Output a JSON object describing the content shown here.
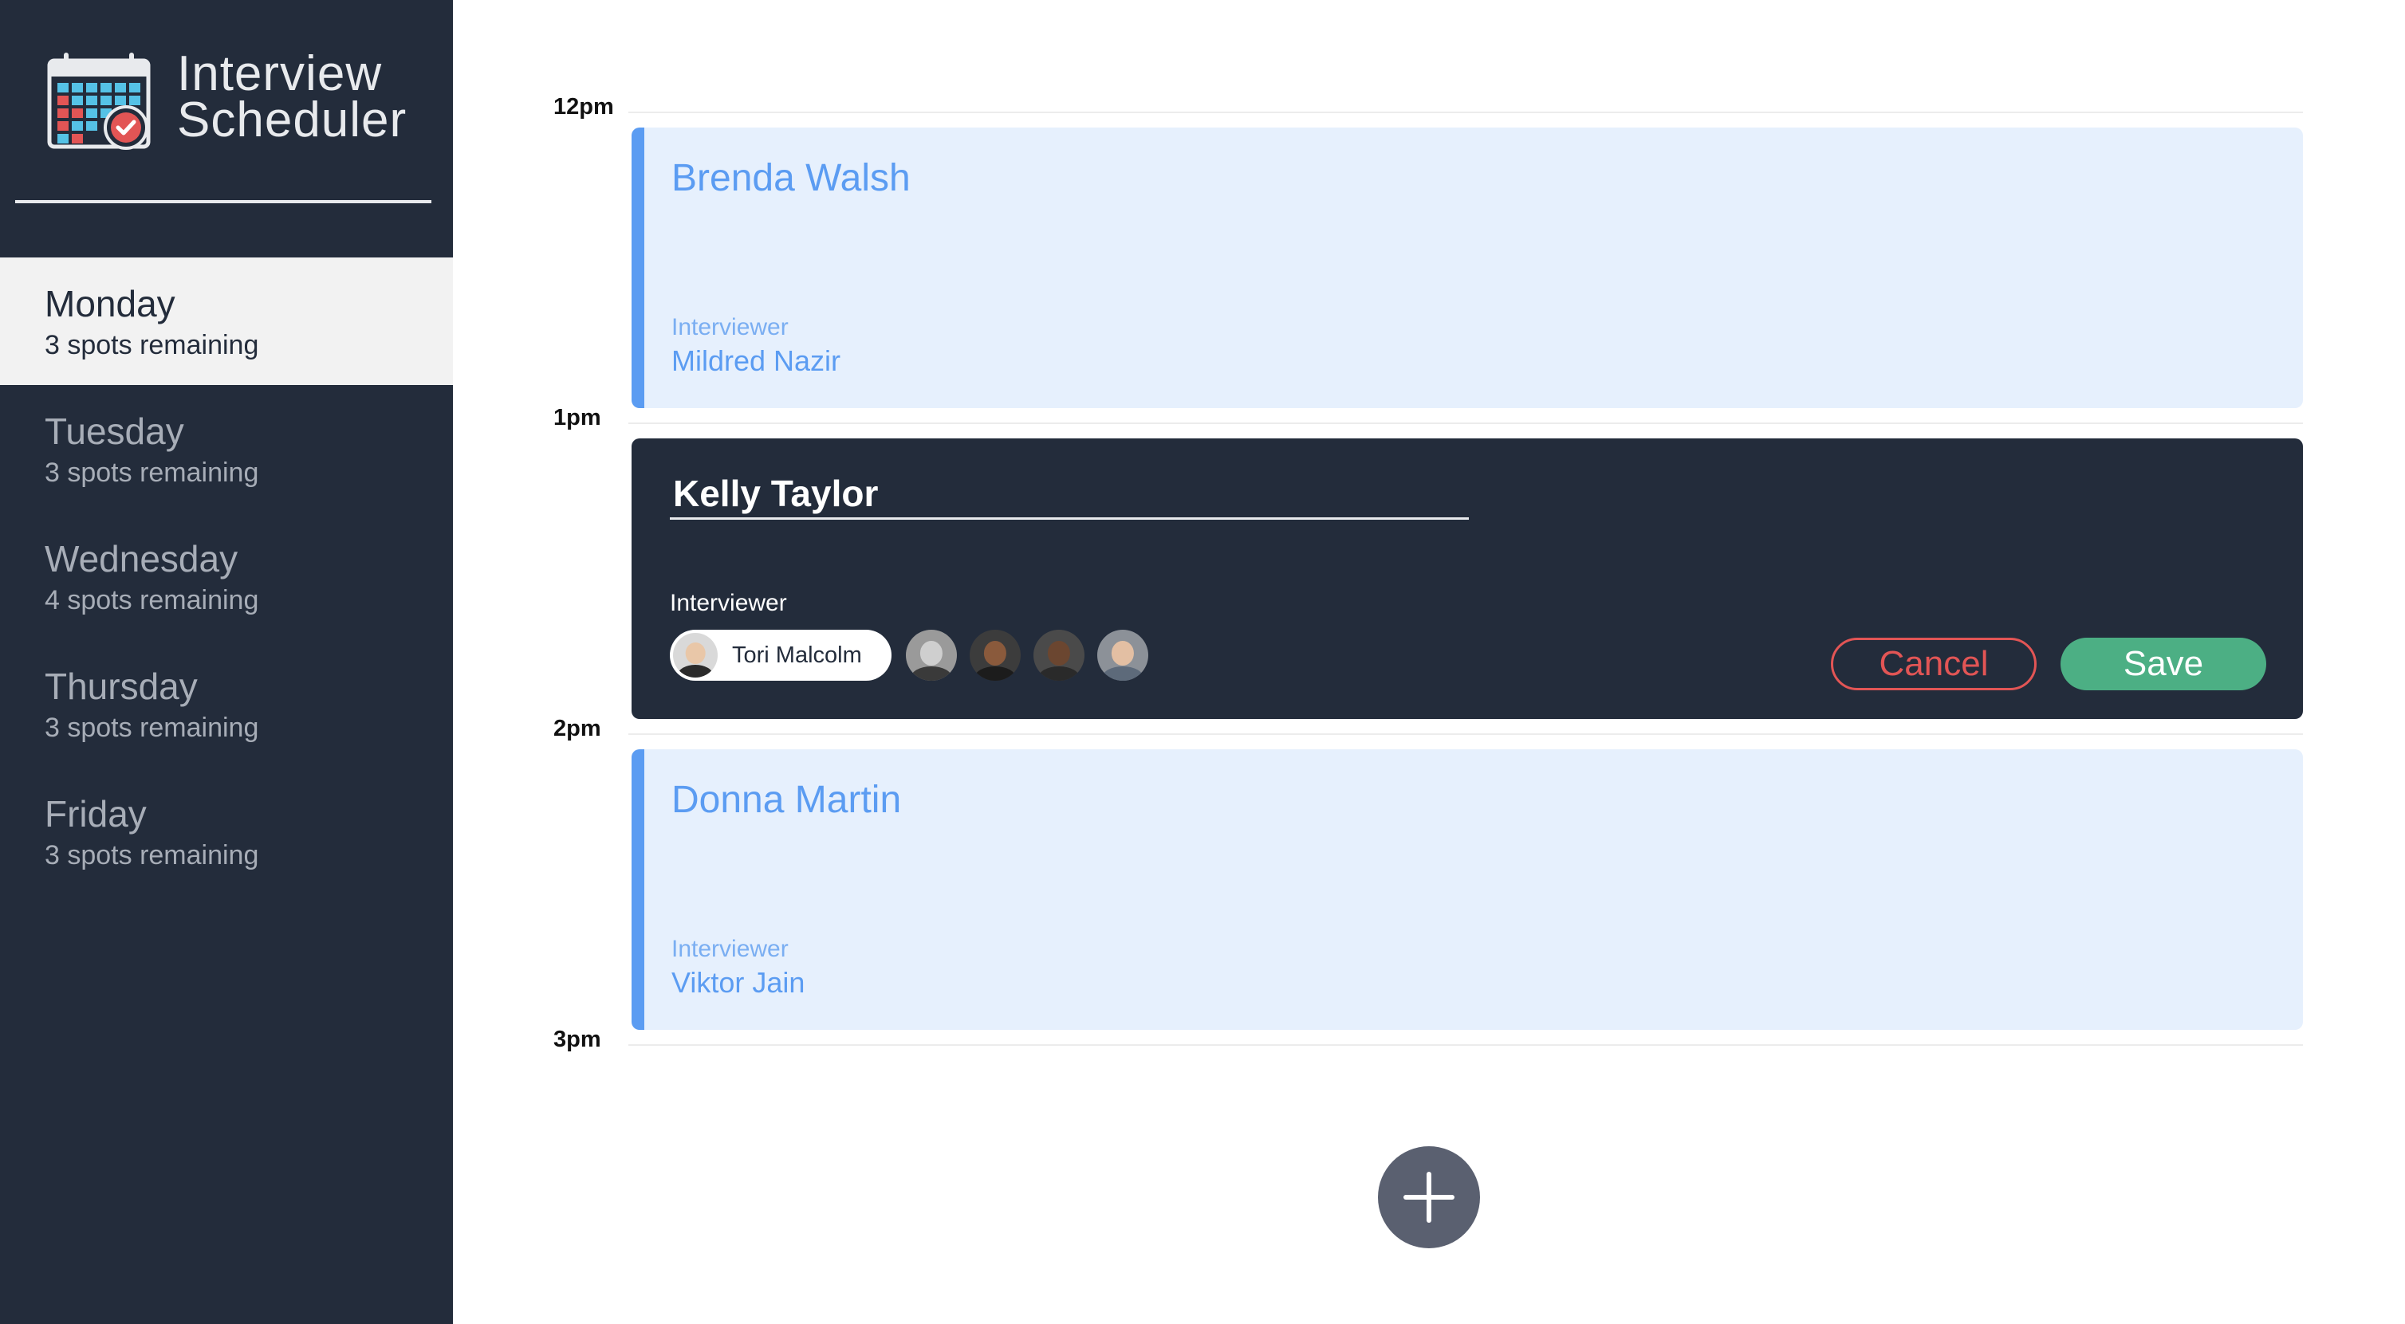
{
  "app": {
    "title_line1": "Interview",
    "title_line2": "Scheduler"
  },
  "sidebar": {
    "days": [
      {
        "name": "Monday",
        "spots": "3 spots remaining",
        "selected": true
      },
      {
        "name": "Tuesday",
        "spots": "3 spots remaining",
        "selected": false
      },
      {
        "name": "Wednesday",
        "spots": "4 spots remaining",
        "selected": false
      },
      {
        "name": "Thursday",
        "spots": "3 spots remaining",
        "selected": false
      },
      {
        "name": "Friday",
        "spots": "3 spots remaining",
        "selected": false
      }
    ]
  },
  "schedule": {
    "times": [
      "12pm",
      "1pm",
      "2pm",
      "3pm"
    ],
    "appointments": [
      {
        "student": "Brenda Walsh",
        "interviewer_label": "Interviewer",
        "interviewer": "Mildred Nazir"
      },
      {
        "student_value": "Kelly Taylor",
        "interviewer_label": "Interviewer",
        "selected_interviewer": "Tori Malcolm",
        "cancel_label": "Cancel",
        "save_label": "Save"
      },
      {
        "student": "Donna Martin",
        "interviewer_label": "Interviewer",
        "interviewer": "Viktor Jain"
      }
    ]
  },
  "icons": {
    "logo": "calendar-check-icon",
    "add": "plus-icon"
  },
  "colors": {
    "sidebar_bg": "#232c3b",
    "accent_blue": "#5b9cf2",
    "appointment_bg": "#e6f0fd",
    "cancel_red": "#e25555",
    "save_green": "#4caf84",
    "add_button": "#5a6070"
  }
}
